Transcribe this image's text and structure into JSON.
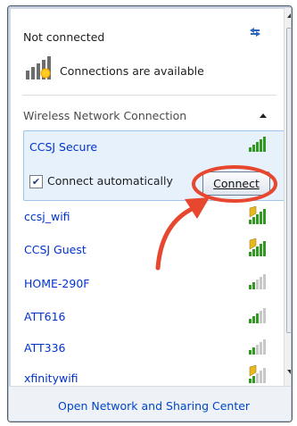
{
  "header": {
    "status": "Not connected",
    "availability": "Connections are available"
  },
  "section": {
    "title": "Wireless Network Connection"
  },
  "selected_network": {
    "name": "CCSJ Secure",
    "checkbox_label": "Connect automatically",
    "checkbox_checked": true,
    "connect_label": "Connect"
  },
  "networks": [
    {
      "name": "ccsj_wifi",
      "secured": true,
      "signal_bars": 4
    },
    {
      "name": "CCSJ Guest",
      "secured": true,
      "signal_bars": 4
    },
    {
      "name": "HOME-290F",
      "secured": false,
      "signal_bars": 2
    },
    {
      "name": "ATT616",
      "secured": false,
      "signal_bars": 3
    },
    {
      "name": "ATT336",
      "secured": false,
      "signal_bars": 2
    },
    {
      "name": "xfinitywifi",
      "secured": true,
      "signal_bars": 2
    }
  ],
  "footer": {
    "link": "Open Network and Sharing Center"
  },
  "colors": {
    "link": "#0033cc",
    "signal_green": "#2f9a1f",
    "signal_gray": "#c8c8c8",
    "annotation_red": "#e8472f"
  }
}
